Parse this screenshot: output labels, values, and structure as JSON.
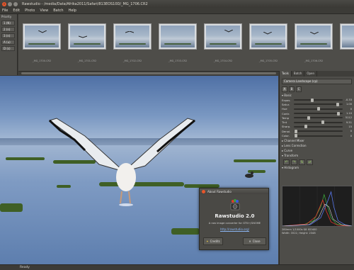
{
  "window": {
    "title": "Rawstudio - /media/Data/Afrika2011/Safari/813EOS10D/_MG_1706.CR2"
  },
  "menu": [
    "File",
    "Edit",
    "Photo",
    "View",
    "Batch",
    "Help"
  ],
  "priority": {
    "label": "Priority",
    "buttons": [
      "1 (N)",
      "2 (n)",
      "3 (n)",
      "A (u)",
      "D (s)"
    ]
  },
  "filmstrip": {
    "thumbnails": [
      "_MG_1700.CR2",
      "_MG_1701.CR2",
      "_MG_1702.CR2",
      "_MG_1703.CR2",
      "_MG_1704.CR2",
      "_MG_1705.CR2",
      "_MG_1706.CR2"
    ]
  },
  "tools": {
    "tabs": [
      "Tools",
      "Batch",
      "Open"
    ],
    "profile": "Camera Landscape (cp)",
    "snapshots": [
      "A",
      "B",
      "C"
    ],
    "basic_label": "Basic",
    "sliders": [
      {
        "label": "Expos.",
        "value": "-0.33",
        "pos": 0.38
      },
      {
        "label": "Satur.",
        "value": "1.00",
        "pos": 0.9
      },
      {
        "label": "Hue",
        "value": "0",
        "pos": 0.5
      },
      {
        "label": "Contr.",
        "value": "1.10",
        "pos": 0.92
      },
      {
        "label": "Temp",
        "value": "5112",
        "pos": 0.3
      },
      {
        "label": "Tint",
        "value": "9.51",
        "pos": 0.6
      },
      {
        "label": "Sharp.",
        "value": "15",
        "pos": 0.25
      },
      {
        "label": "Denoi.",
        "value": "0",
        "pos": 0.05
      },
      {
        "label": "Color.",
        "value": "0",
        "pos": 0.05
      }
    ],
    "collapsed_sections": [
      "Channel Mixer",
      "Lens Correction",
      "Curve"
    ],
    "transform_label": "Transform",
    "transform_buttons": [
      "rotate-left-icon",
      "rotate-right-icon",
      "flip-icon",
      "mirror-icon"
    ],
    "histogram_label": "Histogram",
    "exif_line1": "280mm 1/1000s f/8 ISO400",
    "exif_line2": "Width: 3522, Height: 2348"
  },
  "about_dialog": {
    "title": "About Rawstudio",
    "app_name": "Rawstudio 2.0",
    "description": "A raw image converter for GTK+/GNOME",
    "link": "http://rawstudio.org/",
    "credits_label": "Credits",
    "close_label": "Close"
  },
  "status": "Ready",
  "colors": {
    "accent": "#e8562a",
    "background": "#3c3b37",
    "panel": "#4e4d49"
  }
}
